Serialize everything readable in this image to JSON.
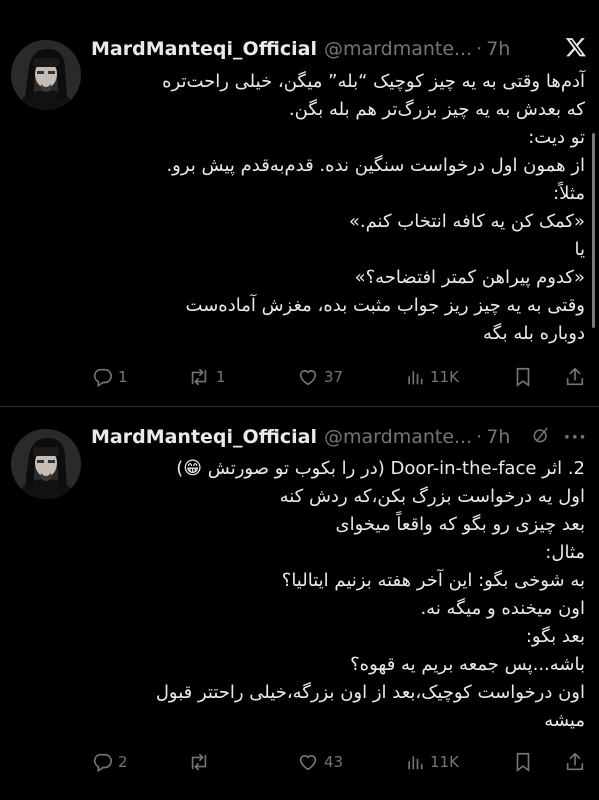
{
  "tweets": [
    {
      "author_name": "MardManteqi_Official",
      "handle": "@mardmante...",
      "separator": "·",
      "time": "7h",
      "header_icon": "x-logo-icon",
      "lines": [
        "آدم‌ها وقتی به یه چیز کوچیک “بله” میگن، خیلی راحت‌تره",
        "که بعدش به یه چیز بزرگ‌تر هم بله بگن.",
        "تو دیت:",
        "از همون اول درخواست سنگین نده. قدم‌به‌قدم پیش برو.",
        "مثلاً:",
        "«کمک کن یه کافه انتخاب کنم.»",
        "یا",
        "«کدوم پیراهن کمتر افتضاحه؟»",
        "وقتی به یه چیز ریز جواب مثبت بده، مغزش آماده‌ست",
        "دوباره بله بگه"
      ],
      "stats": {
        "replies": "1",
        "reposts": "1",
        "likes": "37",
        "views": "11K"
      }
    },
    {
      "author_name": "MardManteqi_Official",
      "handle": "@mardmante...",
      "separator": "·",
      "time": "7h",
      "header_icon": "grok-icon",
      "more_label": "···",
      "lines": [
        "2. اثر Door-in-the-face (در را بکوب تو صورتش 😁)",
        "اول یه درخواست بزرگ بکن،که ردش کنه",
        "بعد چیزی رو بگو که واقعاً میخوای",
        "مثال:",
        "به شوخی بگو: این آخر هفته بزنیم ایتالیا؟",
        "اون میخنده و میگه نه.",
        "بعد بگو:",
        "باشه...پس جمعه بریم یه قهوه؟",
        "اون درخواست کوچیک،بعد از اون بزرگه،خیلی راحتتر قبول",
        "میشه"
      ],
      "stats": {
        "replies": "2",
        "reposts": "",
        "likes": "43",
        "views": "11K"
      }
    }
  ],
  "colors": {
    "background": "#000000",
    "text": "#e7e9ea",
    "muted": "#71767b",
    "divider": "#2f3336"
  }
}
